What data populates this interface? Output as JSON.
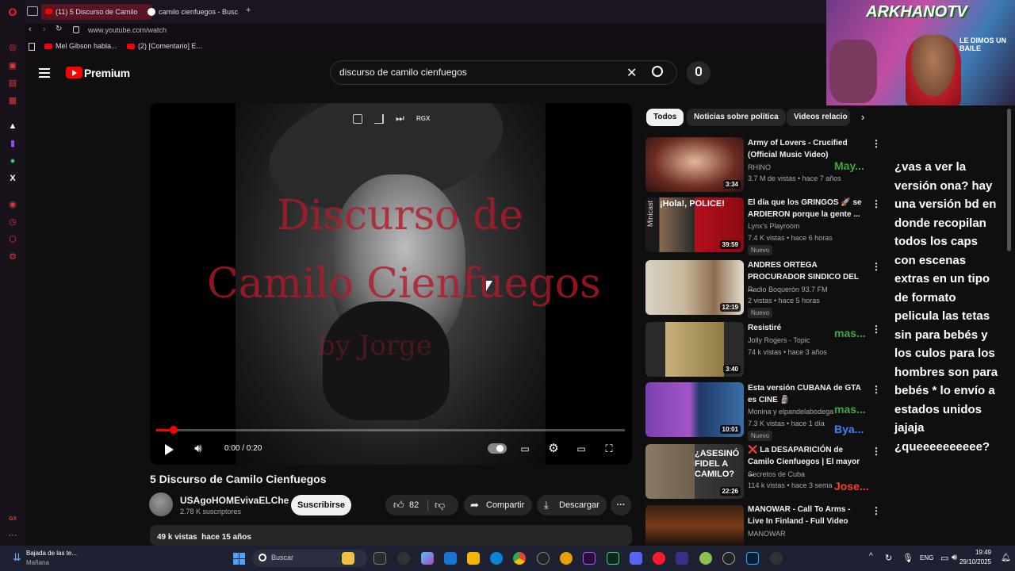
{
  "browser": {
    "tabs": [
      {
        "label": "(11) 5 Discurso de Camilo",
        "active": true
      },
      {
        "label": "camilo cienfuegos - Busc",
        "active": false
      }
    ],
    "new_tab": "+",
    "url": "www.youtube.com/watch",
    "bookmarks": [
      "Mel Gibson habla...",
      "(2) [Comentario] E..."
    ]
  },
  "youtube": {
    "logo_text": "Premium",
    "search_value": "discurso de camilo cienfuegos"
  },
  "player": {
    "overlay_text_1": "Discurso de",
    "overlay_text_2": "Camilo Cienfuegos",
    "overlay_text_3": "by Jorge",
    "rgx_label": "RGX",
    "time": "0:00 / 0:20",
    "progress_fraction": 0.038
  },
  "video": {
    "title": "5 Discurso de Camilo Cienfuegos",
    "channel": "USAgoHOMEvivaELChe",
    "subscribers": "2.78 K suscriptores",
    "subscribe_label": "Suscribirse",
    "likes": "82",
    "share_label": "Compartir",
    "download_label": "Descargar",
    "views_date": "49 k vistas  hace 15 años"
  },
  "chips": [
    "Todos",
    "Noticias sobre política",
    "Videos relacio"
  ],
  "recommendations": [
    {
      "title": "Army of Lovers - Crucified (Official Music Video)",
      "channel": "RHINO",
      "meta": "3.7 M de vistas • hace 7 años",
      "duration": "3:34",
      "nuevo": ""
    },
    {
      "title": "El día que los GRINGOS 🚀 se ARDIERON porque la gente ...",
      "channel": "Lynx's Playroom",
      "meta": "7.4 K vistas • hace 6 horas",
      "duration": "39:59",
      "nuevo": "Nuevo"
    },
    {
      "title": "ANDRES ORTEGA PROCURADOR SINDICO DEL ...",
      "channel": "Radio Boquerón 93.7 FM",
      "meta": "2 vistas • hace 5 horas",
      "duration": "12:19",
      "nuevo": "Nuevo"
    },
    {
      "title": "Resistiré",
      "channel": "Jolly Rogers - Topic",
      "meta": "74 k vistas • hace 3 años",
      "duration": "3:40",
      "nuevo": ""
    },
    {
      "title": "Esta versión CUBANA de GTA es CINE 🗿",
      "channel": "Monina y elpandelabodega",
      "meta": "7.3 K vistas • hace 1 día",
      "duration": "10:01",
      "nuevo": "Nuevo"
    },
    {
      "title": "❌ La DESAPARICIÓN de Camilo Cienfuegos | El mayor ...",
      "channel": "Secretos de Cuba",
      "meta": "114 k vistas • hace 3 sema",
      "duration": "22:26",
      "nuevo": ""
    },
    {
      "title": "MANOWAR - Call To Arms - Live In Finland - Full Video",
      "channel": "MANOWAR",
      "meta": "",
      "duration": "",
      "nuevo": ""
    }
  ],
  "thumb_texts": {
    "t2_side": "Minicast",
    "t2_banner": "¡Hola!, POLICE!",
    "t6_big": "¿ASESINÓ FIDEL A CAMILO?"
  },
  "chat": {
    "names": [
      "May...",
      "mas...",
      "mas...",
      "Bya...",
      "Jose..."
    ],
    "message": "¿vas a ver la versión ona? hay una versión bd en donde recopilan todos los caps con escenas extras en un tipo de formato pelicula las tetas sin para bebés y los culos para los hombres son para bebés * lo envío a estados unidos jajaja ¿queeeeeeeeee?"
  },
  "webcam": {
    "channel_name": "ARKHANOTV",
    "banner": "LE DIMOS UN BAILE"
  },
  "taskbar": {
    "notification": "Bajada de las te...",
    "notification_sub": "Mañana",
    "search_placeholder": "Buscar",
    "lang": "ENG",
    "time": "19:49",
    "date": "29/10/2025"
  },
  "colors": {
    "accent": "#ff0000",
    "chat_name": "#3ea63a",
    "chat_blue": "#3b82f6",
    "chat_red": "#ff3b30"
  }
}
